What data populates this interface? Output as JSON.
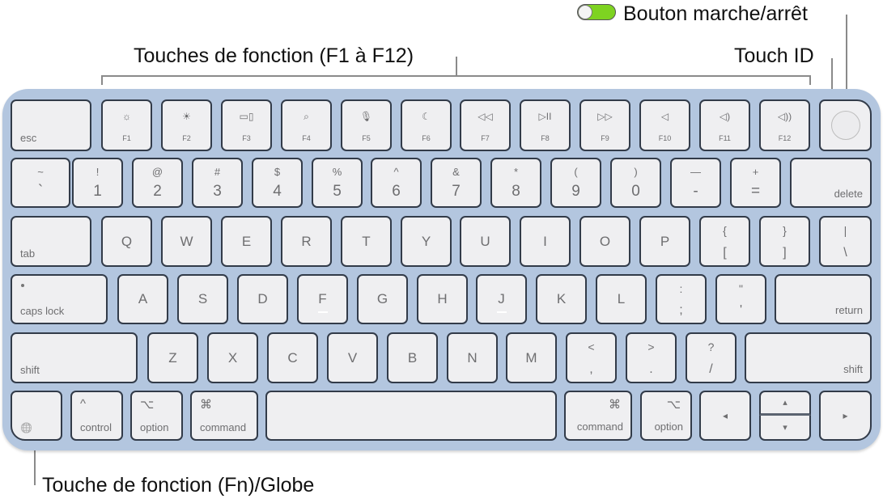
{
  "callouts": {
    "function_keys": "Touches de fonction (F1 à F12)",
    "touch_id": "Touch ID",
    "power": "Bouton marche/arrêt",
    "fn_globe": "Touche de fonction (Fn)/Globe"
  },
  "power_toggle": {
    "state": "on",
    "on_color": "#7ed321"
  },
  "keyboard": {
    "color": "#b3c6df",
    "row1": {
      "esc": "esc",
      "fkeys": [
        {
          "label": "F1",
          "icon": "brightness-down-icon",
          "glyph": "☼"
        },
        {
          "label": "F2",
          "icon": "brightness-up-icon",
          "glyph": "☀"
        },
        {
          "label": "F3",
          "icon": "mission-control-icon",
          "glyph": "▭▯"
        },
        {
          "label": "F4",
          "icon": "spotlight-search-icon",
          "glyph": "⌕"
        },
        {
          "label": "F5",
          "icon": "dictation-mic-icon",
          "glyph": "🎙"
        },
        {
          "label": "F6",
          "icon": "do-not-disturb-moon-icon",
          "glyph": "☾"
        },
        {
          "label": "F7",
          "icon": "rewind-icon",
          "glyph": "◁◁"
        },
        {
          "label": "F8",
          "icon": "play-pause-icon",
          "glyph": "▷II"
        },
        {
          "label": "F9",
          "icon": "fast-forward-icon",
          "glyph": "▷▷"
        },
        {
          "label": "F10",
          "icon": "mute-icon",
          "glyph": "◁"
        },
        {
          "label": "F11",
          "icon": "volume-down-icon",
          "glyph": "◁)"
        },
        {
          "label": "F12",
          "icon": "volume-up-icon",
          "glyph": "◁))"
        }
      ]
    },
    "row2": {
      "keys": [
        {
          "top": "~",
          "bottom": "`"
        },
        {
          "top": "!",
          "bottom": "1"
        },
        {
          "top": "@",
          "bottom": "2"
        },
        {
          "top": "#",
          "bottom": "3"
        },
        {
          "top": "$",
          "bottom": "4"
        },
        {
          "top": "%",
          "bottom": "5"
        },
        {
          "top": "^",
          "bottom": "6"
        },
        {
          "top": "&",
          "bottom": "7"
        },
        {
          "top": "*",
          "bottom": "8"
        },
        {
          "top": "(",
          "bottom": "9"
        },
        {
          "top": ")",
          "bottom": "0"
        },
        {
          "top": "—",
          "bottom": "-"
        },
        {
          "top": "+",
          "bottom": "="
        }
      ],
      "delete": "delete"
    },
    "row3": {
      "tab": "tab",
      "letters": [
        "Q",
        "W",
        "E",
        "R",
        "T",
        "Y",
        "U",
        "I",
        "O",
        "P"
      ],
      "symbols": [
        {
          "top": "{",
          "bottom": "["
        },
        {
          "top": "}",
          "bottom": "]"
        },
        {
          "top": "|",
          "bottom": "\\"
        }
      ]
    },
    "row4": {
      "caps": "caps lock",
      "letters": [
        "A",
        "S",
        "D",
        "F",
        "G",
        "H",
        "J",
        "K",
        "L"
      ],
      "symbols": [
        {
          "top": ":",
          "bottom": ";"
        },
        {
          "top": "\"",
          "bottom": "'"
        }
      ],
      "return": "return"
    },
    "row5": {
      "shift_left": "shift",
      "letters": [
        "Z",
        "X",
        "C",
        "V",
        "B",
        "N",
        "M"
      ],
      "symbols": [
        {
          "top": "<",
          "bottom": ","
        },
        {
          "top": ">",
          "bottom": "."
        },
        {
          "top": "?",
          "bottom": "/"
        }
      ],
      "shift_right": "shift"
    },
    "row6": {
      "fn_glyph": "🌐",
      "control": {
        "label": "control",
        "glyph": "^"
      },
      "option_left": {
        "label": "option",
        "glyph": "⌥"
      },
      "command_left": {
        "label": "command",
        "glyph": "⌘"
      },
      "command_right": {
        "label": "command",
        "glyph": "⌘"
      },
      "option_right": {
        "label": "option",
        "glyph": "⌥"
      },
      "arrows": {
        "left": "◂",
        "up": "▴",
        "down": "▾",
        "right": "▸"
      }
    }
  }
}
